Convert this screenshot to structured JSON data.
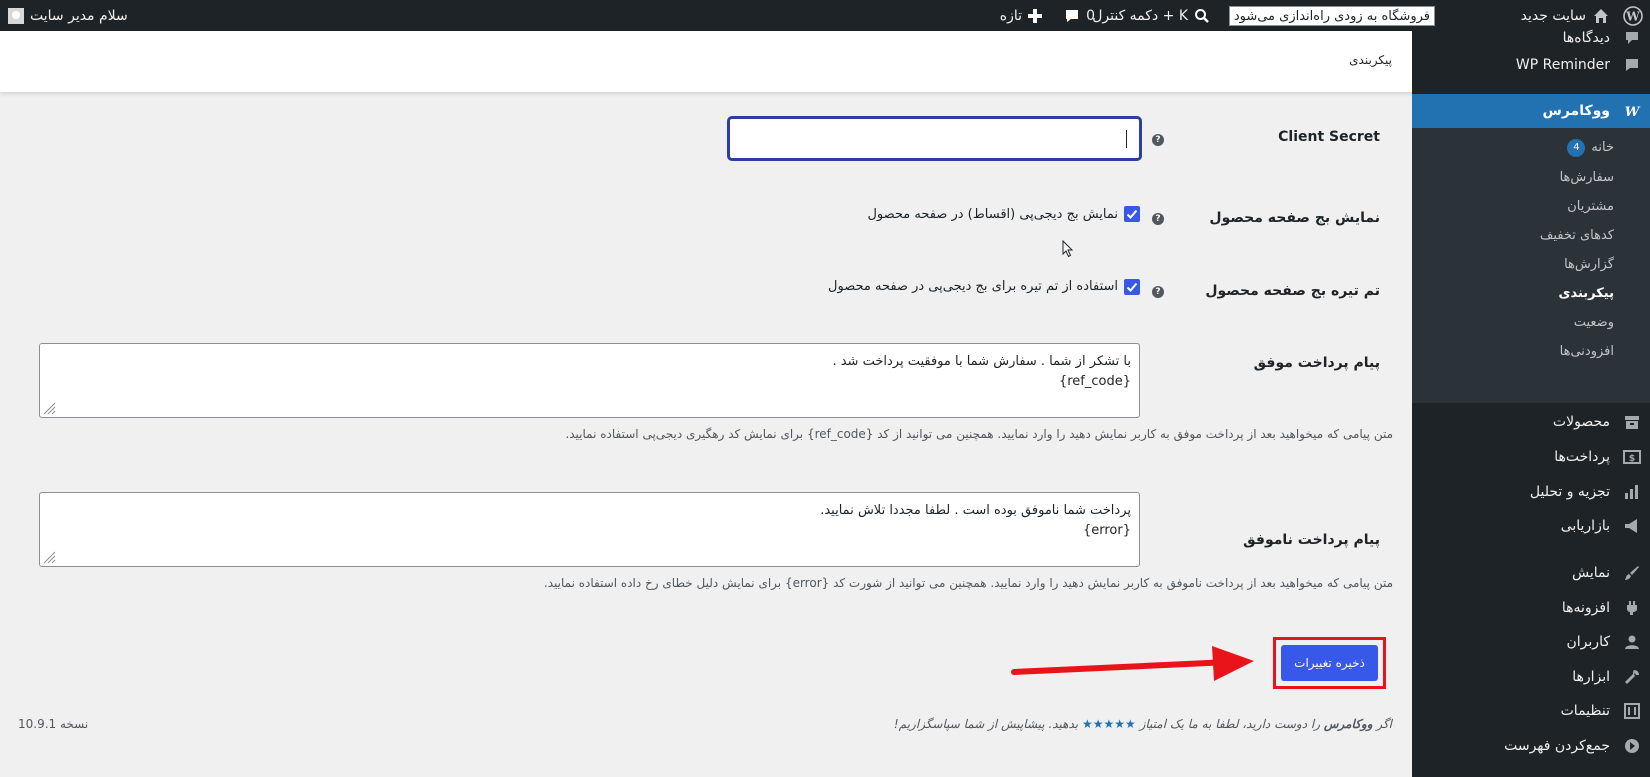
{
  "admin_bar": {
    "site_name": "سایت جدید",
    "search_text": "فروشگاه به زودی راه‌اندازی می‌شود",
    "ctrl_k": "دکمه کنترل + K",
    "comments_count": "0",
    "new_label": "تازه",
    "greeting": "سلام مدیر سایت"
  },
  "sidebar": {
    "top_partial": "دیدگاه‌ها",
    "wp_reminder": "WP Reminder",
    "woocommerce": "ووکامرس",
    "submenu": {
      "home": "خانه",
      "home_badge": "4",
      "orders": "سفارش‌ها",
      "customers": "مشتریان",
      "coupons": "کدهای تخفیف",
      "reports": "گزارش‌ها",
      "settings": "پیکربندی",
      "status": "وضعیت",
      "extensions": "افزودنی‌ها"
    },
    "products": "محصولات",
    "payments": "پرداخت‌ها",
    "analytics": "تجزیه و تحلیل",
    "marketing": "بازاریابی",
    "appearance": "نمایش",
    "plugins": "افزونه‌ها",
    "users": "کاربران",
    "tools": "ابزارها",
    "settings": "تنظیمات",
    "collapse": "جمع‌کردن فهرست"
  },
  "header": {
    "breadcrumb": "پیکربندی"
  },
  "form": {
    "client_secret_label": "Client Secret",
    "client_secret_value": "",
    "badge_label": "نمایش بج صفحه محصول",
    "badge_checkbox_text": "نمایش بج دیجی‌پی (اقساط) در صفحه محصول",
    "badge_checked": true,
    "dark_theme_label": "تم تیره بج صفحه محصول",
    "dark_theme_checkbox_text": "استفاده از تم تیره برای بج دیجی‌پی در صفحه محصول",
    "dark_theme_checked": true,
    "success_label": "پیام پرداخت موفق",
    "success_line1": "با تشکر از شما . سفارش شما با موفقیت پرداخت شد .",
    "success_line2": "{ref_code}",
    "success_desc": "متن پیامی که میخواهید بعد از پرداخت موفق به کاربر نمایش دهید را وارد نمایید. همچنین می توانید از کد {ref_code} برای نمایش کد رهگیری دیجی‌پی استفاده نمایید.",
    "fail_label": "پیام پرداخت ناموفق",
    "fail_line1": "پرداخت شما ناموفق بوده است . لطفا مجددا تلاش نمایید.",
    "fail_line2": "{error}",
    "fail_desc": "متن پیامی که میخواهید بعد از پرداخت ناموفق به کاربر نمایش دهید را وارد نمایید. همچنین می توانید از شورت کد {error} برای نمایش دلیل خطای رخ داده استفاده نمایید.",
    "save_button": "ذخیره تغییرات"
  },
  "footer": {
    "rating_prefix": "اگر",
    "rating_brand": "ووکامرس",
    "rating_mid": "را دوست دارید، لطفا به ما یک امتیاز",
    "rating_stars": "★★★★★",
    "rating_suffix": "بدهید. پیشاپیش از شما سپاسگزاریم!",
    "version": "نسخه 10.9.1"
  },
  "colors": {
    "admin_bg": "#1d2327",
    "submenu_bg": "#2c3338",
    "active_menu": "#2271b1",
    "save_button": "#3858e9",
    "highlight_red": "#e8141a"
  },
  "icons": {
    "wordpress": "wordpress-icon",
    "home": "home-icon",
    "search": "search-icon",
    "comment": "comment-icon",
    "plus": "plus-icon",
    "help": "help-icon",
    "check": "check-icon"
  }
}
